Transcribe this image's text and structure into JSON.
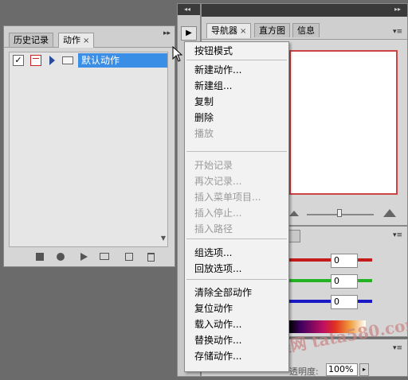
{
  "left_panel": {
    "tabs": [
      {
        "label": "历史记录"
      },
      {
        "label": "动作",
        "close": "×"
      }
    ],
    "action_set": {
      "label": "默认动作"
    }
  },
  "right_top": {
    "tabs": [
      {
        "label": "导航器",
        "close": "×"
      },
      {
        "label": "直方图"
      },
      {
        "label": "信息"
      }
    ]
  },
  "right_mid": {
    "values": [
      "0",
      "0",
      "0"
    ],
    "slider_colors": [
      "#c41a1a",
      "#22b222",
      "#1a1ac4"
    ]
  },
  "right_bot": {
    "opacity_label": "透明度:",
    "opacity_value": "100%"
  },
  "menu": {
    "items": [
      {
        "label": "按钮模式",
        "enabled": true
      },
      {
        "label": "新建动作...",
        "enabled": true
      },
      {
        "label": "新建组...",
        "enabled": true
      },
      {
        "label": "复制",
        "enabled": true
      },
      {
        "label": "删除",
        "enabled": true
      },
      {
        "label": "播放",
        "enabled": false
      },
      {
        "label": "开始记录",
        "enabled": false
      },
      {
        "label": "再次记录...",
        "enabled": false
      },
      {
        "label": "插入菜单项目...",
        "enabled": false
      },
      {
        "label": "插入停止...",
        "enabled": false
      },
      {
        "label": "插入路径",
        "enabled": false
      },
      {
        "label": "组选项...",
        "enabled": true
      },
      {
        "label": "回放选项...",
        "enabled": true
      },
      {
        "label": "清除全部动作",
        "enabled": true
      },
      {
        "label": "复位动作",
        "enabled": true
      },
      {
        "label": "载入动作...",
        "enabled": true
      },
      {
        "label": "替换动作...",
        "enabled": true
      },
      {
        "label": "存储动作...",
        "enabled": true
      }
    ]
  },
  "watermark": "PS教程网 tata580.com"
}
